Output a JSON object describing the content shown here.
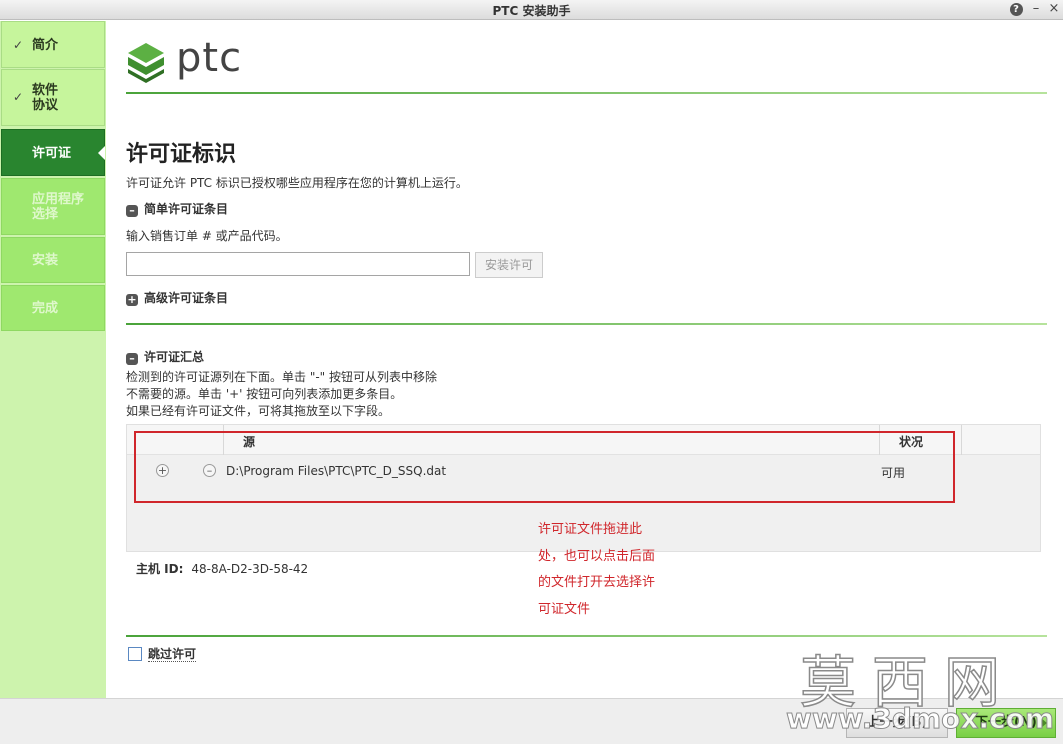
{
  "window": {
    "title": "PTC 安装助手"
  },
  "sidebar": {
    "items": [
      {
        "label": "简介",
        "state": "done"
      },
      {
        "label": "软件\n协议",
        "state": "done"
      },
      {
        "label": "许可证",
        "state": "active"
      },
      {
        "label": "应用程序\n选择",
        "state": "todo"
      },
      {
        "label": "安装",
        "state": "todo"
      },
      {
        "label": "完成",
        "state": "todo"
      }
    ]
  },
  "logo": {
    "text": "ptc"
  },
  "page": {
    "title": "许可证标识",
    "description": "许可证允许 PTC 标识已授权哪些应用程序在您的计算机上运行。"
  },
  "simple": {
    "section_label": "简单许可证条目",
    "instruction": "输入销售订单 # 或产品代码。",
    "input_value": "",
    "install_button": "安装许可"
  },
  "advanced": {
    "section_label": "高级许可证条目"
  },
  "summary": {
    "section_label": "许可证汇总",
    "line1": "检测到的许可证源列在下面。单击 \"-\" 按钮可从列表中移除",
    "line2": "不需要的源。单击 '+' 按钮可向列表添加更多条目。",
    "line3": "如果已经有许可证文件，可将其拖放至以下字段。"
  },
  "table": {
    "headers": {
      "source": "源",
      "status": "状况"
    },
    "rows": [
      {
        "source": "D:\\Program Files\\PTC\\PTC_D_SSQ.dat",
        "status": "可用"
      }
    ]
  },
  "annotation": {
    "lines": [
      "许可证文件拖进此",
      "处，也可以点击后面",
      "的文件打开去选择许",
      "可证文件"
    ]
  },
  "host": {
    "label": "主机 ID:",
    "value": "48-8A-D2-3D-58-42"
  },
  "skip": {
    "label": "跳过许可"
  },
  "footer": {
    "back_label": "上一步(B)",
    "next_label": "下一步(N)"
  },
  "watermark": {
    "big": "莫西网",
    "small": "www.3dmox.com"
  },
  "colors": {
    "accent": "#29852f",
    "sidebar_bg": "#cdf3ad",
    "annotation": "#d0262b"
  }
}
